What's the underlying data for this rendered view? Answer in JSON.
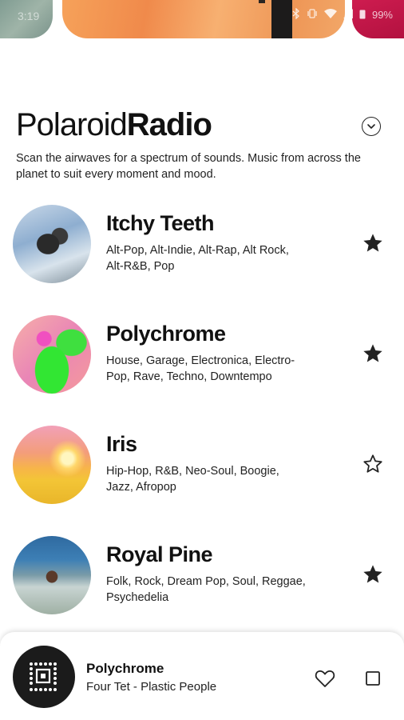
{
  "status_bar": {
    "time": "3:19",
    "battery": "99%"
  },
  "header": {
    "title_light": "Polaroid",
    "title_bold": "Radio",
    "description": "Scan the airwaves for a spectrum of sounds. Music from across the planet to suit every moment and mood."
  },
  "stations": [
    {
      "name": "Itchy Teeth",
      "genres": "Alt-Pop, Alt-Indie, Alt-Rap, Alt Rock, Alt-R&B, Pop",
      "favorite": true
    },
    {
      "name": "Polychrome",
      "genres": "House, Garage, Electronica, Electro-Pop, Rave, Techno, Downtempo",
      "favorite": true
    },
    {
      "name": "Iris",
      "genres": "Hip-Hop, R&B, Neo-Soul, Boogie, Jazz, Afropop",
      "favorite": false
    },
    {
      "name": "Royal Pine",
      "genres": "Folk, Rock, Dream Pop, Soul, Reggae, Psychedelia",
      "favorite": true
    }
  ],
  "player": {
    "station": "Polychrome",
    "track": "Four Tet - Plastic People"
  },
  "icons": {
    "dropdown": "chevron-down-icon",
    "favorite_on": "star-filled-icon",
    "favorite_off": "star-outline-icon",
    "like": "heart-icon",
    "stop": "stop-icon"
  }
}
